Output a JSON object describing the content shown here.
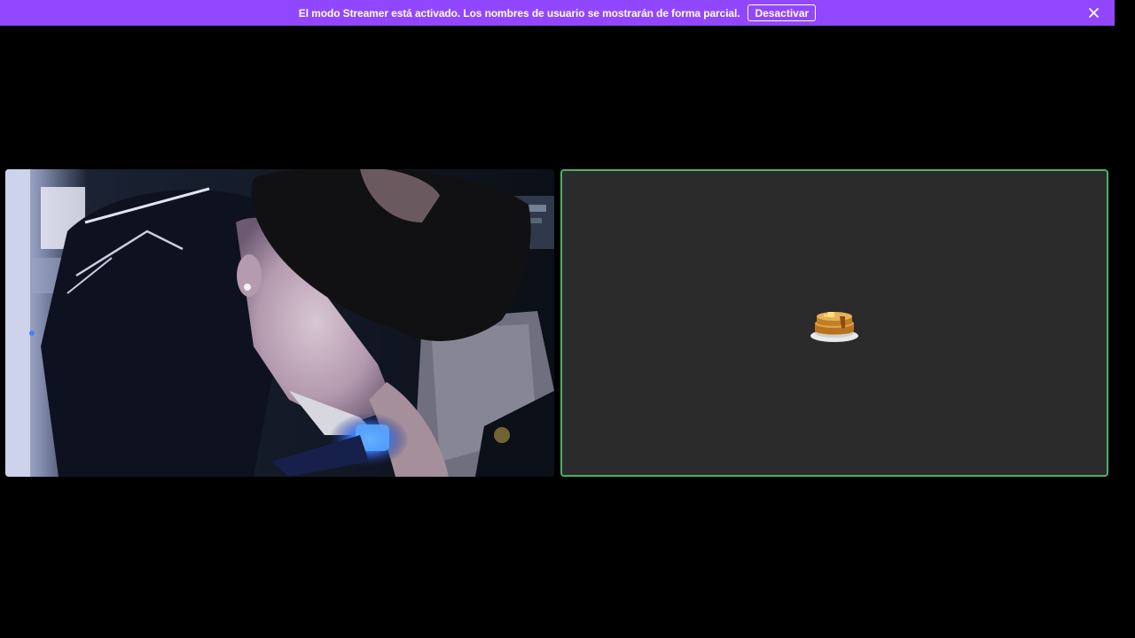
{
  "banner": {
    "message": "El modo Streamer está activado. Los nombres de usuario se mostrarán de forma parcial.",
    "action_label": "Desactivar",
    "close_icon": "close-icon",
    "background_color": "#9147ff"
  },
  "call": {
    "participants": [
      {
        "type": "video",
        "description_icon": "camera-feed"
      },
      {
        "type": "avatar",
        "avatar_icon": "pancakes-icon",
        "speaking_ring_color": "#4caf6a",
        "tile_color": "#2b2b2b"
      }
    ]
  }
}
